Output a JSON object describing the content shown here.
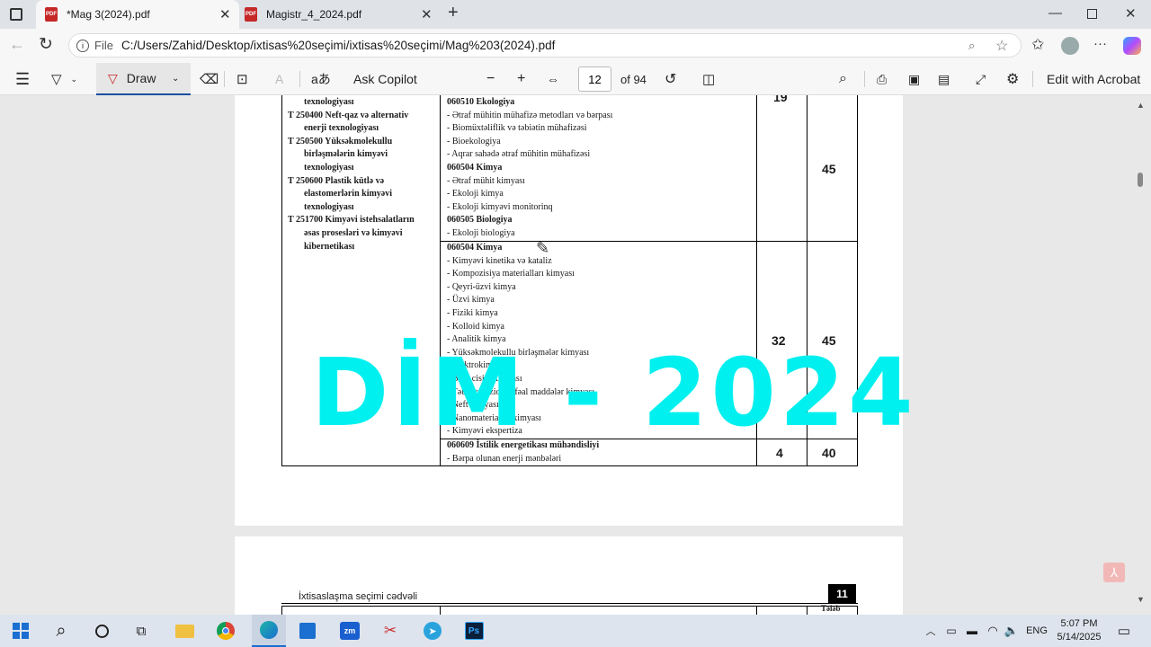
{
  "tabs": [
    {
      "title": "*Mag 3(2024).pdf"
    },
    {
      "title": "Magistr_4_2024.pdf"
    }
  ],
  "address": {
    "label": "File",
    "url": "C:/Users/Zahid/Desktop/ixtisas%20seçimi/ixtisas%20seçimi/Mag%203(2024).pdf"
  },
  "toolbar": {
    "draw": "Draw",
    "read_aloud": "aあ",
    "copilot": "Ask Copilot",
    "page_current": "12",
    "page_total": "of 94",
    "edit": "Edit with Acrobat"
  },
  "table": {
    "left_lines": [
      "texnologiyası",
      "T 250400 Neft-qaz və alternativ",
      "enerji texnologiyası",
      "T 250500 Yüksəkmolekullu",
      "birləşmələrin kimyəvi",
      "texnologiyası",
      "T 250600 Plastik kütlə və",
      "elastomerlərin kimyəvi",
      "texnologiyası",
      "T 251700 Kimyəvi istehsalatların",
      "əsas prosesləri və kimyəvi",
      "kibernetikası"
    ],
    "block1_lines": [
      "060510 Ekologiya",
      "- Ətraf mühitin mühafizə metodları və bərpası",
      "- Biomüxtəliflik və təbiətin mühafizəsi",
      "- Bioekologiya",
      "- Aqrar sahədə ətraf mühitin mühafizəsi",
      "060504 Kimya",
      "- Ətraf mühit kimyası",
      "- Ekoloji kimya",
      "- Ekoloji kimyəvi monitorinq",
      "060505 Biologiya",
      "- Ekoloji biologiya"
    ],
    "block2_lines": [
      "060504 Kimya",
      "- Kimyəvi kinetika və kataliz",
      "- Kompozisiya materialları kimyası",
      "- Qeyri-üzvi kimya",
      "- Üzvi kimya",
      "- Fiziki kimya",
      "- Kolloid kimya",
      "- Analitik kimya",
      "- Yüksəkmolekullu birləşmələr kimyası",
      "- Elektrokimya",
      "- Bərk cisim kimyası",
      "- Təbii və fizioloji fəal maddələr kimyası",
      "- Neft kimyası",
      "- Nanomateriallar kimyası",
      "- Kimyəvi ekspertiza"
    ],
    "block3_lines": [
      "060609 İstilik energetikası mühəndisliyi",
      "- Bərpa olunan enerji mənbələri"
    ],
    "row1": {
      "a": "19",
      "b": "45"
    },
    "row2": {
      "a": "32",
      "b": "45"
    },
    "row3": {
      "a": "4",
      "b": "40"
    }
  },
  "watermark": "DİM - 2024",
  "page2": {
    "caption": "İxtisaslaşma seçimi cədvəli",
    "page_number": "11",
    "header_fragment": "Tələb"
  },
  "tray": {
    "lang": "ENG",
    "time": "5:07 PM",
    "date": "5/14/2025"
  },
  "colors": {
    "watermark": "#00f0f0",
    "pdf_red": "#c62828"
  }
}
